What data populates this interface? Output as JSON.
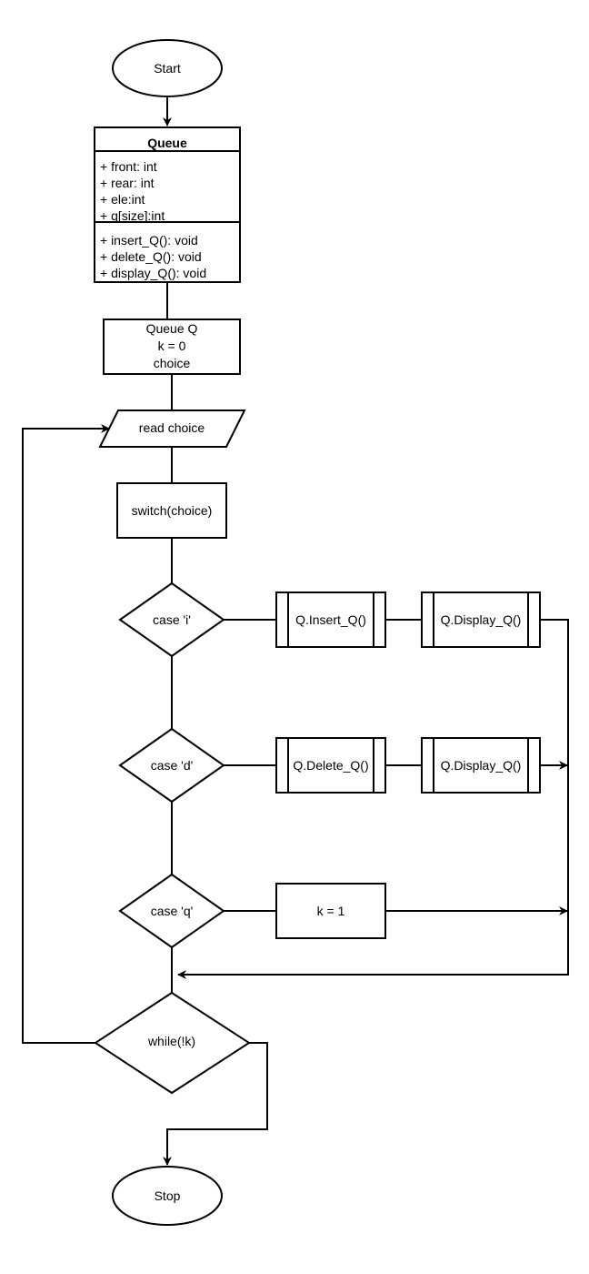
{
  "diagram": {
    "type": "flowchart",
    "start": "Start",
    "stop": "Stop",
    "class_box": {
      "title": "Queue",
      "attributes": [
        "+ front: int",
        "+ rear: int",
        "+ ele:int",
        "+ q[size]:int"
      ],
      "methods": [
        "+ insert_Q(): void",
        "+ delete_Q(): void",
        "+ display_Q(): void"
      ]
    },
    "init_box": [
      "Queue Q",
      "k = 0",
      "choice"
    ],
    "read_input": "read choice",
    "switch_box": "switch(choice)",
    "cases": [
      {
        "label": "case 'i'",
        "actions": [
          "Q.Insert_Q()",
          "Q.Display_Q()"
        ]
      },
      {
        "label": "case 'd'",
        "actions": [
          "Q.Delete_Q()",
          "Q.Display_Q()"
        ]
      },
      {
        "label": "case 'q'",
        "actions": [
          "k = 1"
        ]
      }
    ],
    "loop_condition": "while(!k)"
  }
}
